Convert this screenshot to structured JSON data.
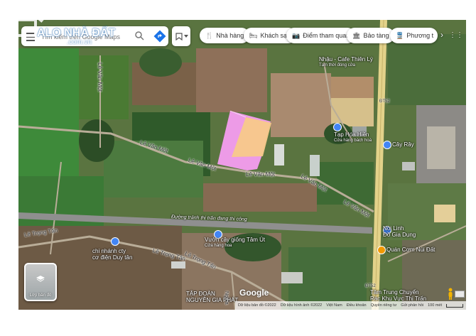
{
  "watermark": {
    "brand": "ALO NHÀ ĐẤT",
    "domain": ".com.vn"
  },
  "search": {
    "placeholder": "Tìm kiếm trên Google Maps"
  },
  "chips": [
    {
      "label": "Nhà hàng",
      "icon": "fork-knife-icon"
    },
    {
      "label": "Khách sạn",
      "icon": "bed-icon"
    },
    {
      "label": "Điểm tham quan",
      "icon": "camera-icon"
    },
    {
      "label": "Bảo tàng",
      "icon": "museum-icon"
    },
    {
      "label": "Phương t",
      "icon": "transit-icon"
    }
  ],
  "map_labels": {
    "le_van_mot_1": "Lê Văn Một",
    "le_van_mot_2": "Lê Văn Một",
    "le_van_mot_3": "Lê Văn Một",
    "le_van_mot_4": "Lê Văn Một",
    "le_van_mot_5": "Lê Văn Một",
    "le_van_mot_6": "Lê Văn Một",
    "le_trong_tan_1": "Lê Trọng Tấn",
    "le_trong_tan_2": "Lê Trọng Tấn",
    "le_trong_tan_3": "Lê Trọng Tấn",
    "new_road": "Đường tránh thị trấn  đang thi công",
    "dt_1": "ĐT52",
    "dt_2": "ĐT52",
    "cafe": "Nhậu - Cafe Thiên Lý",
    "cafe_sub": "Tạm thời đóng cửa",
    "taphoa": "Tạp Hóa Hiền",
    "taphoa_sub": "Cửa hàng bách hoá",
    "ray": "Cây Rây",
    "nongsan": "Noi Linh",
    "nongsan_sub": "Đồ Gia Dụng",
    "quancom": "Quán Cơm Núi Đất",
    "vuon": "Vườn cây giống Tâm Út",
    "vuon_sub": "Cửa hàng hoa",
    "chinhanh": "chi nhánh cty",
    "chinhanh_sub": "cơ điện Duy tân",
    "tapdoan": "TẬP ĐOÀN",
    "tapdoan_sub": "NGUYỄN GIA PHÁT",
    "trungtam": "Tâm Trung Chuyển",
    "trungtam_sub": "Rác Khu Vực Thị Trấn",
    "nghia": "Nghĩa"
  },
  "layers_button": {
    "label": "Lớp bản đồ"
  },
  "google": "Google",
  "attribution": {
    "data": "Dữ liệu bản đồ ©2022",
    "imagery": "Dữ liệu hình ảnh ©2022",
    "vietnam": "Việt Nam",
    "terms": "Điều khoản",
    "privacy": "Quyền riêng tư",
    "feedback": "Gửi phản hồi",
    "scale": "100 mét"
  },
  "colors": {
    "plot_pink": "#f59df0",
    "plot_orange": "#f8c98a",
    "road_gray": "#8c8c8c",
    "highway": "#d9c77a"
  }
}
